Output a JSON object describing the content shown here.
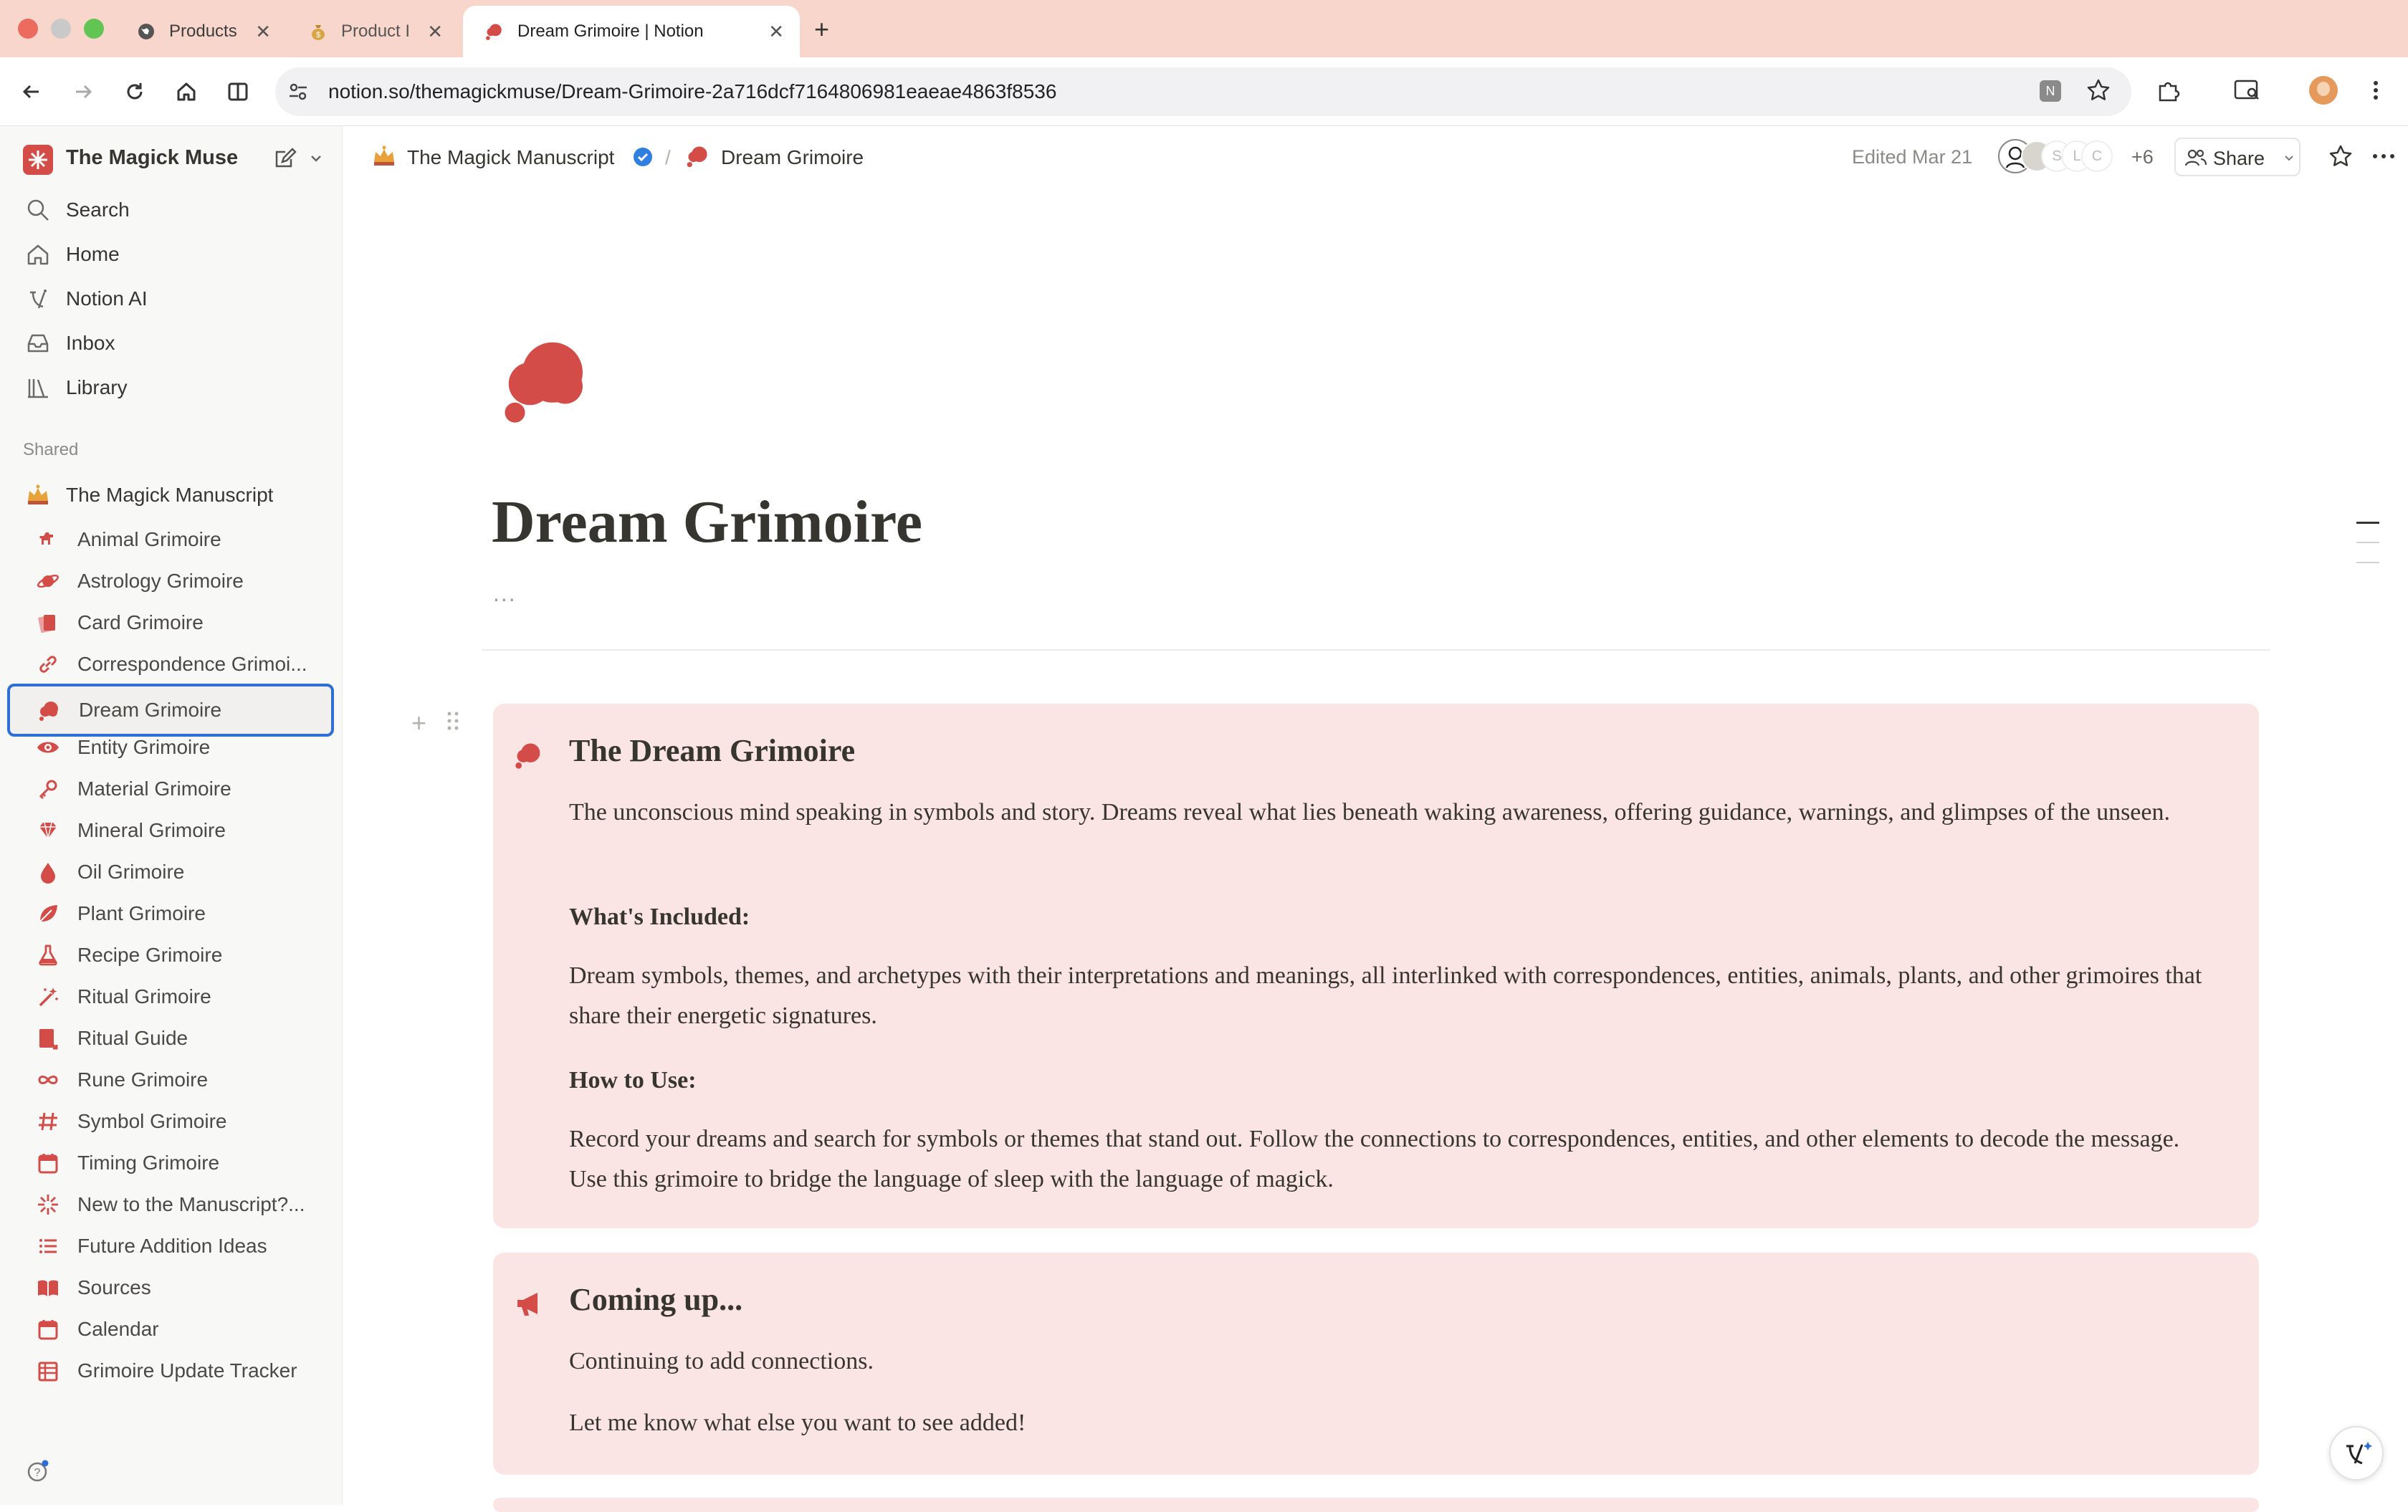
{
  "browser": {
    "tabs": [
      {
        "title": "Products",
        "icon": "globe-icon"
      },
      {
        "title": "Product I",
        "icon": "money-bag-icon"
      },
      {
        "title": "Dream Grimoire | Notion",
        "icon": "dream-cloud-icon"
      }
    ],
    "url": "notion.so/themagickmuse/Dream-Grimoire-2a716dcf7164806981eaeae4863f8536"
  },
  "sidebar": {
    "workspace": "The Magick Muse",
    "nav": [
      {
        "label": "Search",
        "icon": "search-icon"
      },
      {
        "label": "Home",
        "icon": "home-icon"
      },
      {
        "label": "Notion AI",
        "icon": "notion-ai-icon"
      },
      {
        "label": "Inbox",
        "icon": "inbox-icon"
      },
      {
        "label": "Library",
        "icon": "library-icon"
      }
    ],
    "section_label": "Shared",
    "root_page": "The Magick Manuscript",
    "pages": [
      {
        "label": "Animal Grimoire",
        "icon": "dog-icon"
      },
      {
        "label": "Astrology Grimoire",
        "icon": "planet-icon"
      },
      {
        "label": "Card Grimoire",
        "icon": "cards-icon"
      },
      {
        "label": "Correspondence Grimoi...",
        "icon": "link-icon"
      },
      {
        "label": "Dream Grimoire",
        "icon": "dream-cloud-icon"
      },
      {
        "label": "Entity Grimoire",
        "icon": "eye-icon"
      },
      {
        "label": "Material Grimoire",
        "icon": "key-icon"
      },
      {
        "label": "Mineral Grimoire",
        "icon": "gem-icon"
      },
      {
        "label": "Oil Grimoire",
        "icon": "drop-icon"
      },
      {
        "label": "Plant Grimoire",
        "icon": "leaf-icon"
      },
      {
        "label": "Recipe Grimoire",
        "icon": "flask-icon"
      },
      {
        "label": "Ritual Grimoire",
        "icon": "magic-wand-icon"
      },
      {
        "label": "Ritual Guide",
        "icon": "book-arrow-icon"
      },
      {
        "label": "Rune Grimoire",
        "icon": "infinity-icon"
      },
      {
        "label": "Symbol Grimoire",
        "icon": "hashtag-icon"
      },
      {
        "label": "Timing Grimoire",
        "icon": "calendar-icon"
      },
      {
        "label": "New to the Manuscript?...",
        "icon": "sparkle-icon"
      },
      {
        "label": "Future Addition Ideas",
        "icon": "list-icon"
      },
      {
        "label": "Sources",
        "icon": "open-book-icon"
      },
      {
        "label": "Calendar",
        "icon": "calendar-icon"
      },
      {
        "label": "Grimoire Update Tracker",
        "icon": "table-icon"
      }
    ],
    "selected_index": 4
  },
  "topbar": {
    "breadcrumb_root": "The Magick Manuscript",
    "breadcrumb_separator": "/",
    "breadcrumb_current": "Dream Grimoire",
    "edited": "Edited Mar 21",
    "avatar_letters": [
      "S",
      "L",
      "C"
    ],
    "extra_count": "+6",
    "share_label": "Share"
  },
  "page": {
    "title": "Dream Grimoire",
    "properties_toggle": "...",
    "callout1": {
      "heading": "The Dream Grimoire",
      "intro": "The unconscious mind speaking in symbols and story. Dreams reveal what lies beneath waking awareness, offering guidance, warnings, and glimpses of the unseen.",
      "included_heading": "What's Included:",
      "included_text": "Dream symbols, themes, and archetypes with their interpretations and meanings, all interlinked with correspondences, entities, animals, plants, and other grimoires that share their energetic signatures.",
      "howto_heading": "How to Use:",
      "howto_text": "Record your dreams and search for symbols or themes that stand out. Follow the connections to correspondences, entities, and other elements to decode the message. Use this grimoire to bridge the language of sleep with the language of magick."
    },
    "callout2": {
      "heading": "Coming up...",
      "line1": "Continuing to add connections.",
      "line2": "Let me know what else you want to see added!"
    }
  },
  "colors": {
    "accent_red": "#d44c47",
    "callout_bg": "#fbe4e4",
    "tabbar_bg": "#f9d6cc",
    "selection_border": "#2d6fd6"
  }
}
